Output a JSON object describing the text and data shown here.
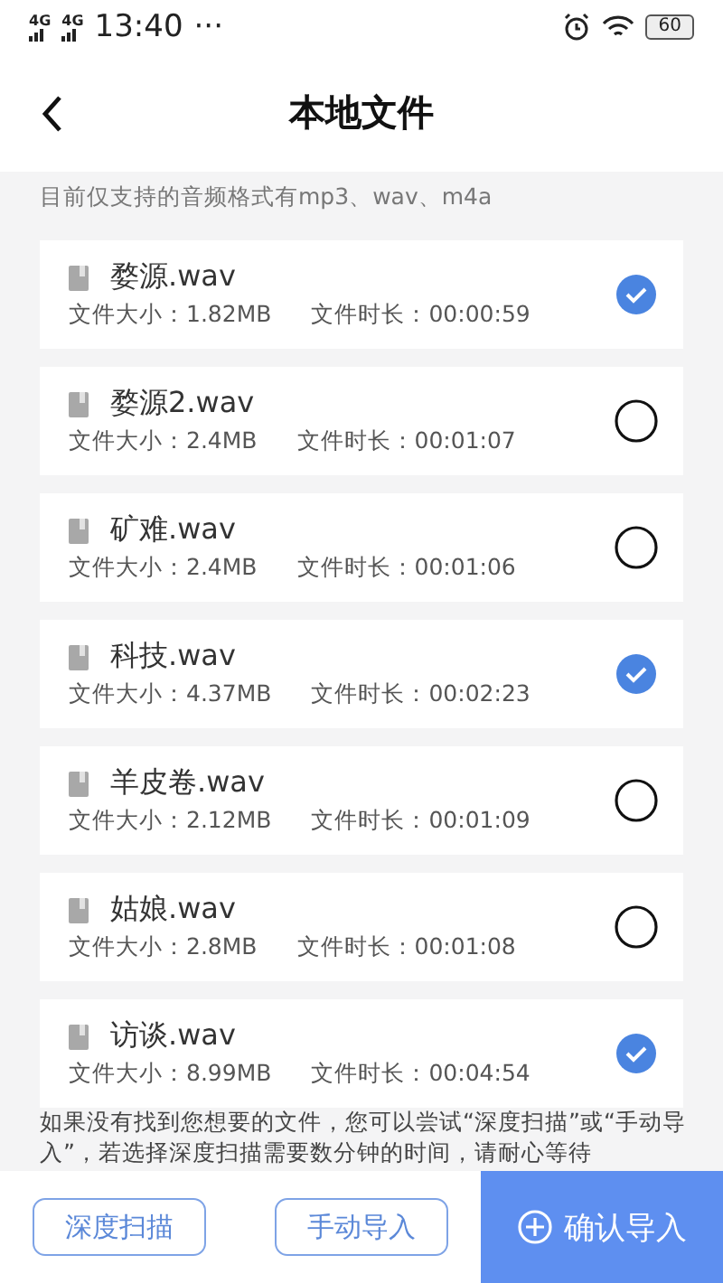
{
  "status_bar": {
    "network_1": "4G",
    "network_2": "4G",
    "time": "13:40",
    "more": "···",
    "battery": "60"
  },
  "header": {
    "title": "本地文件"
  },
  "notice": "目前仅支持的音频格式有mp3、wav、m4a",
  "files": [
    {
      "name": "婺源.wav",
      "size_label": "文件大小：",
      "size": "1.82MB",
      "duration_label": "文件时长：",
      "duration": "00:00:59",
      "selected": true
    },
    {
      "name": "婺源2.wav",
      "size_label": "文件大小：",
      "size": "2.4MB",
      "duration_label": "文件时长：",
      "duration": "00:01:07",
      "selected": false
    },
    {
      "name": "矿难.wav",
      "size_label": "文件大小：",
      "size": "2.4MB",
      "duration_label": "文件时长：",
      "duration": "00:01:06",
      "selected": false
    },
    {
      "name": "科技.wav",
      "size_label": "文件大小：",
      "size": "4.37MB",
      "duration_label": "文件时长：",
      "duration": "00:02:23",
      "selected": true
    },
    {
      "name": "羊皮卷.wav",
      "size_label": "文件大小：",
      "size": "2.12MB",
      "duration_label": "文件时长：",
      "duration": "00:01:09",
      "selected": false
    },
    {
      "name": "姑娘.wav",
      "size_label": "文件大小：",
      "size": "2.8MB",
      "duration_label": "文件时长：",
      "duration": "00:01:08",
      "selected": false
    },
    {
      "name": "访谈.wav",
      "size_label": "文件大小：",
      "size": "8.99MB",
      "duration_label": "文件时长：",
      "duration": "00:04:54",
      "selected": true
    }
  ],
  "hint": "如果没有找到您想要的文件，您可以尝试“深度扫描”或“手动导入”，若选择深度扫描需要数分钟的时间，请耐心等待",
  "buttons": {
    "deep_scan": "深度扫描",
    "manual_import": "手动导入",
    "confirm": "确认导入"
  }
}
